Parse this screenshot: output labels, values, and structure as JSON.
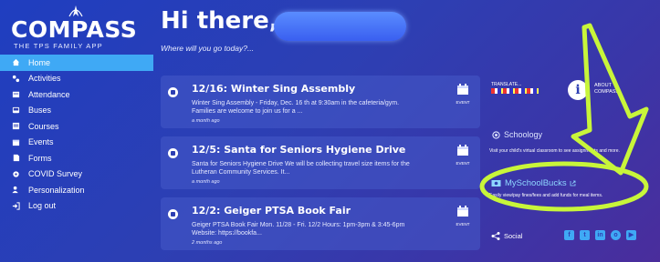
{
  "app": {
    "logo_text": "COMPASS",
    "logo_tagline": "THE TPS FAMILY APP"
  },
  "nav": [
    {
      "label": "Home",
      "icon": "home-icon",
      "active": true
    },
    {
      "label": "Activities",
      "icon": "activities-icon"
    },
    {
      "label": "Attendance",
      "icon": "attendance-icon"
    },
    {
      "label": "Buses",
      "icon": "bus-icon"
    },
    {
      "label": "Courses",
      "icon": "courses-icon"
    },
    {
      "label": "Events",
      "icon": "calendar-icon"
    },
    {
      "label": "Forms",
      "icon": "forms-icon"
    },
    {
      "label": "COVID Survey",
      "icon": "gear-icon"
    },
    {
      "label": "Personalization",
      "icon": "person-icon"
    },
    {
      "label": "Log out",
      "icon": "logout-icon"
    }
  ],
  "header": {
    "greeting": "Hi there,",
    "subtitle": "Where will you go today?..."
  },
  "events": [
    {
      "title": "12/16: Winter Sing Assembly",
      "description": "Winter Sing Assembly - Friday, Dec. 16 th at 9:30am in the cafeteria/gym. Families are welcome to join us for a ...",
      "time": "a month ago",
      "badge": "EVENT"
    },
    {
      "title": "12/5: Santa for Seniors Hygiene Drive",
      "description": "Santa for Seniors Hygiene Drive We will be collecting travel size items for the Lutheran Community Services. It...",
      "time": "a month ago",
      "badge": "EVENT"
    },
    {
      "title": "12/2: Geiger PTSA Book Fair",
      "description": "Geiger PTSA Book Fair Mon. 11/28 - Fri. 12/2 Hours: 1pm-3pm & 3:45-6pm Website: https://bookfa...",
      "time": "2 months ago",
      "badge": "EVENT"
    }
  ],
  "right_panel": {
    "translate": "TRANSLATE...",
    "about_line1": "ABOUT",
    "about_line2": "COMPASS",
    "schoology": "Schoology",
    "schoology_desc": "Visit your child's virtual classroom to see assignments and more.",
    "myschoolbucks": "MySchoolBucks",
    "myschoolbucks_desc": "Easily view/pay fines/fees and add funds for meal items.",
    "social": "Social"
  },
  "colors": {
    "active_nav": "#3fa9f5",
    "annotation": "#c8f53a"
  }
}
